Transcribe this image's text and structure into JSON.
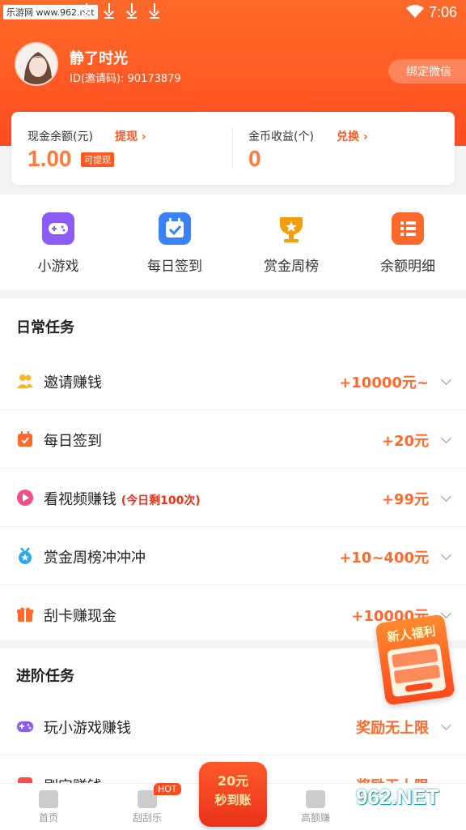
{
  "status_bar": {
    "watermark": "乐游网 www.962.net",
    "time": "7:06"
  },
  "profile": {
    "name": "静了时光",
    "id_text": "ID(邀请码): 90173879",
    "bind_button": "绑定微信"
  },
  "balance": {
    "cash_label": "现金余额(元)",
    "cash_link": "提现 ›",
    "cash_value": "1.00",
    "cash_badge": "可提现",
    "coin_label": "金币收益(个)",
    "coin_link": "兑换 ›",
    "coin_value": "0"
  },
  "quick_links": [
    {
      "label": "小游戏",
      "icon": "gamepad-icon",
      "color": "#8b5cf6"
    },
    {
      "label": "每日签到",
      "icon": "calendar-check-icon",
      "color": "#3b82f6"
    },
    {
      "label": "赏金周榜",
      "icon": "trophy-icon",
      "color": "#f59e0b"
    },
    {
      "label": "余额明细",
      "icon": "list-icon",
      "color": "#ff6a2c"
    }
  ],
  "daily": {
    "title": "日常任务",
    "tasks": [
      {
        "name": "邀请赚钱",
        "note": "",
        "reward": "+10000元~",
        "icon": "users-icon",
        "color": "#f5b728"
      },
      {
        "name": "每日签到",
        "note": "",
        "reward": "+20元",
        "icon": "calendar-icon",
        "color": "#ff6a2c"
      },
      {
        "name": "看视频赚钱",
        "note": "(今日剩100次)",
        "reward": "+99元",
        "icon": "play-icon",
        "color": "#f0508a"
      },
      {
        "name": "赏金周榜冲冲冲",
        "note": "",
        "reward": "+10~400元",
        "icon": "medal-icon",
        "color": "#2aa8e8"
      },
      {
        "name": "刮卡赚现金",
        "note": "",
        "reward": "+10000元",
        "icon": "gift-icon",
        "color": "#ff6a2c"
      }
    ]
  },
  "advanced": {
    "title": "进阶任务",
    "tasks": [
      {
        "name": "玩小游戏赚钱",
        "note": "",
        "reward": "奖励无上限",
        "icon": "gamepad-icon",
        "color": "#8b5cf6"
      },
      {
        "name": "刷宝赚钱",
        "note": "",
        "reward": "奖励无上限",
        "icon": "app-icon",
        "color": "#ff4b4b"
      }
    ]
  },
  "newbie": {
    "label": "新人福利"
  },
  "bottom_nav": {
    "home": "首页",
    "scratch": "刮刮乐",
    "hot_badge": "HOT",
    "center_amount": "20元",
    "center_text": "秒到账",
    "high": "高额赚",
    "watermark": "962.NET"
  }
}
